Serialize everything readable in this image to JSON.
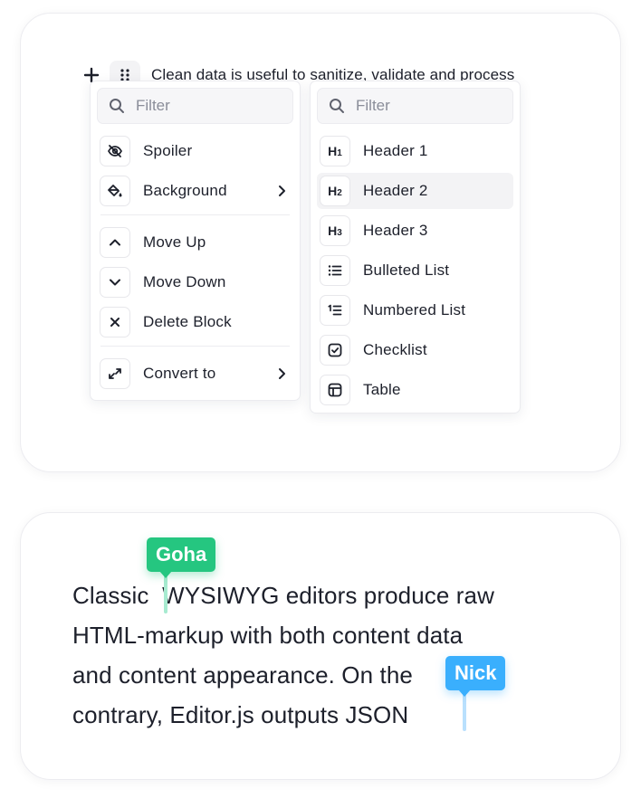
{
  "editor": {
    "block_text": "Clean data is useful to sanitize, validate and process"
  },
  "block_tunes": {
    "filter_placeholder": "Filter",
    "items": [
      {
        "label": "Spoiler",
        "icon": "eye-off-icon"
      },
      {
        "label": "Background",
        "icon": "paint-bucket-icon",
        "has_submenu": true
      },
      {
        "label": "Move Up",
        "icon": "chevron-up-icon"
      },
      {
        "label": "Move Down",
        "icon": "chevron-down-icon"
      },
      {
        "label": "Delete Block",
        "icon": "cross-icon"
      },
      {
        "label": "Convert to",
        "icon": "convert-arrows-icon",
        "has_submenu": true
      }
    ]
  },
  "convert_menu": {
    "filter_placeholder": "Filter",
    "items": [
      {
        "label": "Header 1",
        "icon": "heading-1-icon",
        "glyph": "H",
        "level": "1"
      },
      {
        "label": "Header 2",
        "icon": "heading-2-icon",
        "glyph": "H",
        "level": "2",
        "active": true
      },
      {
        "label": "Header 3",
        "icon": "heading-3-icon",
        "glyph": "H",
        "level": "3"
      },
      {
        "label": "Bulleted List",
        "icon": "bulleted-list-icon"
      },
      {
        "label": "Numbered List",
        "icon": "numbered-list-icon"
      },
      {
        "label": "Checklist",
        "icon": "checklist-icon"
      },
      {
        "label": "Table",
        "icon": "table-icon"
      }
    ]
  },
  "collab": {
    "paragraph_lines": [
      "Classic  WYSIWYG editors produce raw",
      "HTML-markup with both content data",
      "and content appearance. On the",
      "contrary, Editor.js outputs JSON"
    ],
    "cursors": [
      {
        "name": "Goha",
        "color": "#25c680"
      },
      {
        "name": "Nick",
        "color": "#3aaffd"
      }
    ]
  }
}
